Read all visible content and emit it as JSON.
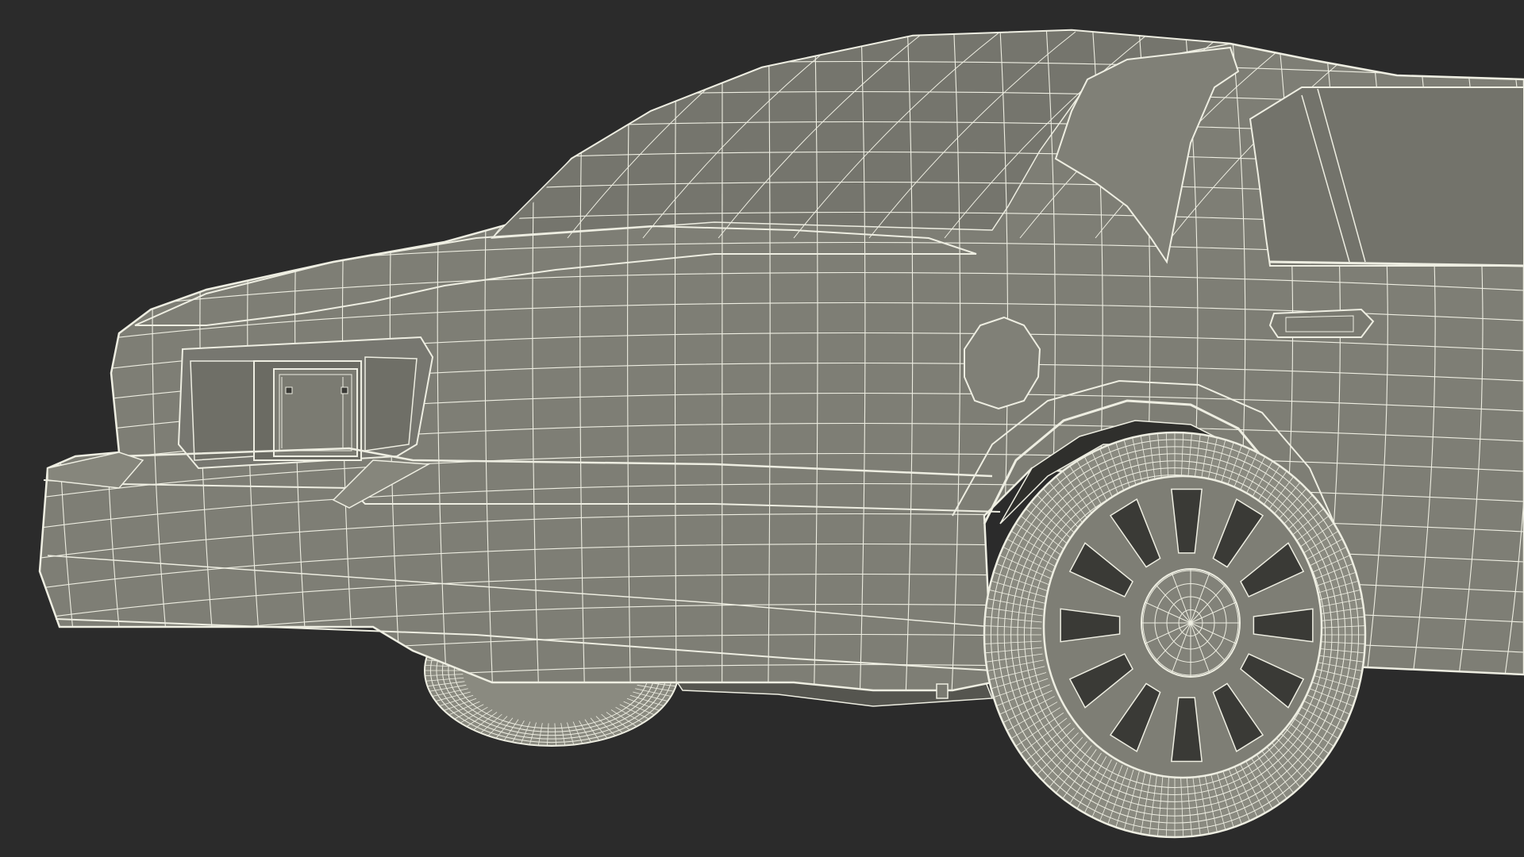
{
  "scene": {
    "subject": "car-wireframe",
    "colors": {
      "background": "#2b2b2b",
      "body_fill": "#7e7e75",
      "body_shade": "#6f6f67",
      "glass_fill": "#73736b",
      "tire_fill": "#8a8a80",
      "wire": "#eeeee2",
      "dark_opening": "#3a3a36"
    }
  }
}
